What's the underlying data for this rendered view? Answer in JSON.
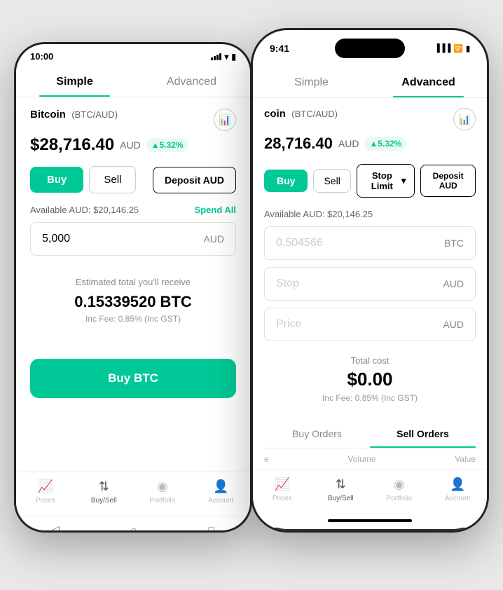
{
  "left_phone": {
    "status_bar": {
      "time": "10:00"
    },
    "tabs": {
      "simple": "Simple",
      "advanced": "Advanced"
    },
    "active_tab": "simple",
    "coin": {
      "name": "Bitcoin",
      "pair": "(BTC/AUD)",
      "price": "$28,716.40",
      "currency": "AUD",
      "change": "▲5.32%"
    },
    "buttons": {
      "buy": "Buy",
      "sell": "Sell",
      "deposit": "Deposit AUD"
    },
    "available": {
      "label": "Available AUD: $20,146.25",
      "spend_all": "Spend All"
    },
    "input_aud": {
      "value": "5,000",
      "currency": "AUD"
    },
    "estimated": {
      "label": "Estimated total you'll receive",
      "value": "0.15339520 BTC",
      "fee": "Inc Fee: 0.85% (Inc GST)"
    },
    "buy_button": "Buy BTC",
    "nav": [
      {
        "icon": "📈",
        "label": "Prices"
      },
      {
        "icon": "↕",
        "label": "Buy/Sell",
        "active": true
      },
      {
        "icon": "🥧",
        "label": "Portfolio"
      },
      {
        "icon": "👤",
        "label": "Account"
      }
    ],
    "android_nav": [
      "◁",
      "○",
      "□"
    ]
  },
  "right_phone": {
    "status_bar": {
      "time": "9:41"
    },
    "tabs": {
      "simple": "Simple",
      "advanced": "Advanced"
    },
    "active_tab": "advanced",
    "coin": {
      "name": "coin",
      "pair": "(BTC/AUD)",
      "price": "28,716.40",
      "currency": "AUD",
      "change": "▲5.32%"
    },
    "buttons": {
      "buy": "Buy",
      "sell": "Sell",
      "stop_limit": "Stop Limit",
      "deposit": "Deposit AUD"
    },
    "available": {
      "label": "Available AUD: $20,146.25"
    },
    "fields": [
      {
        "placeholder": "0.504566",
        "currency": "BTC"
      },
      {
        "placeholder": "Stop",
        "currency": "AUD"
      },
      {
        "placeholder": "Price",
        "currency": "AUD"
      }
    ],
    "total": {
      "label": "Total cost",
      "value": "$0.00",
      "fee": "Inc Fee: 0.85% (Inc GST)"
    },
    "orders": {
      "buy_tab": "Buy Orders",
      "sell_tab": "Sell Orders",
      "active": "sell",
      "header": {
        "col1": "e",
        "col2": "Volume",
        "col3": "Value"
      }
    },
    "nav": [
      {
        "icon": "📈",
        "label": "Prices"
      },
      {
        "icon": "↕",
        "label": "Buy/Sell",
        "active": true
      },
      {
        "icon": "🥧",
        "label": "Portfolio"
      },
      {
        "icon": "👤",
        "label": "Account"
      }
    ]
  }
}
